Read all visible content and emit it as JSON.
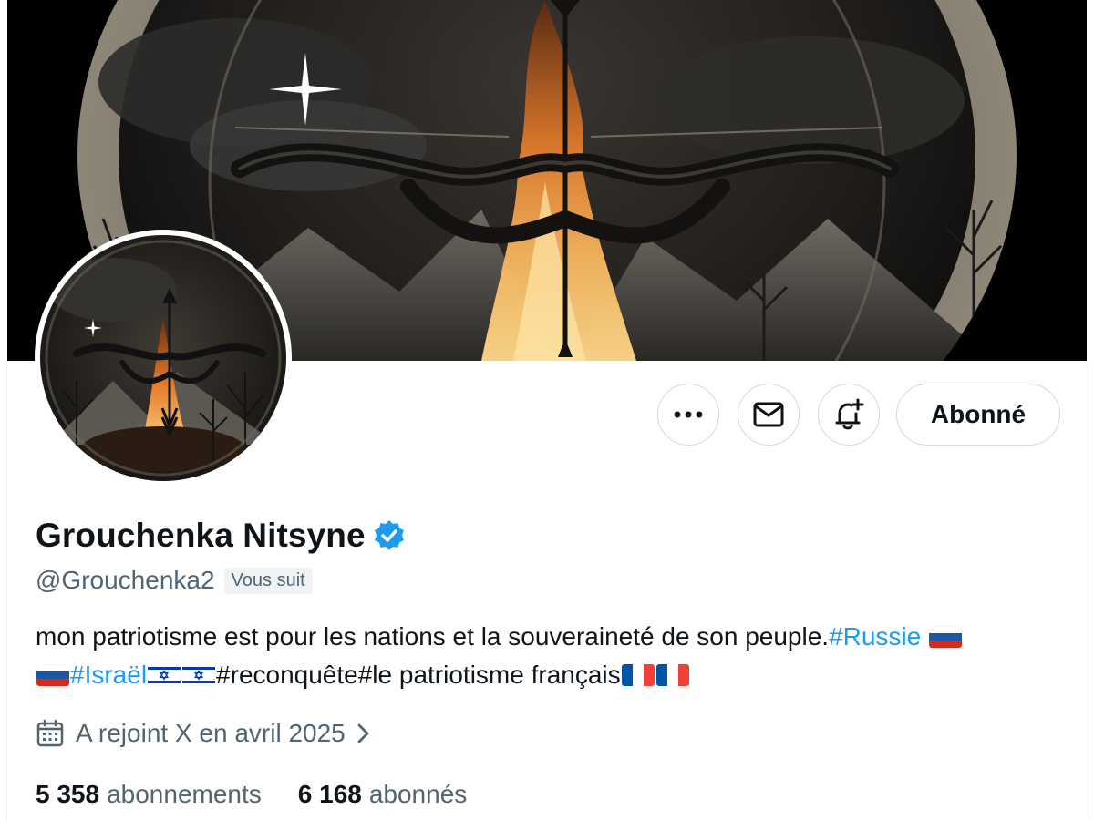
{
  "profile": {
    "display_name": "Grouchenka Nitsyne",
    "handle": "@Grouchenka2",
    "follows_you_badge": "Vous suit",
    "verified": true
  },
  "actions": {
    "more_icon": "more-horizontal-icon",
    "message_icon": "envelope-icon",
    "notify_icon": "bell-plus-icon",
    "follow_label": "Abonné"
  },
  "bio": {
    "text_1": "mon patriotisme est pour les nations et la souveraineté de son peuple.",
    "hashtag_russie": "#Russie",
    "hashtag_israel": "#Israël",
    "text_2": "#reconquête#le patriotisme français",
    "flags": [
      "russia-flag",
      "russia-flag",
      "israel-flag",
      "israel-flag",
      "france-flag",
      "france-flag"
    ]
  },
  "join": {
    "icon": "calendar-icon",
    "label": "A rejoint X en avril 2025"
  },
  "stats": {
    "following_count": "5 358",
    "following_label": "abonnements",
    "followers_count": "6 168",
    "followers_label": "abonnés"
  },
  "colors": {
    "accent": "#1d9bf0",
    "text_primary": "#0f1419",
    "text_secondary": "#536471",
    "border": "#cfd9de"
  }
}
